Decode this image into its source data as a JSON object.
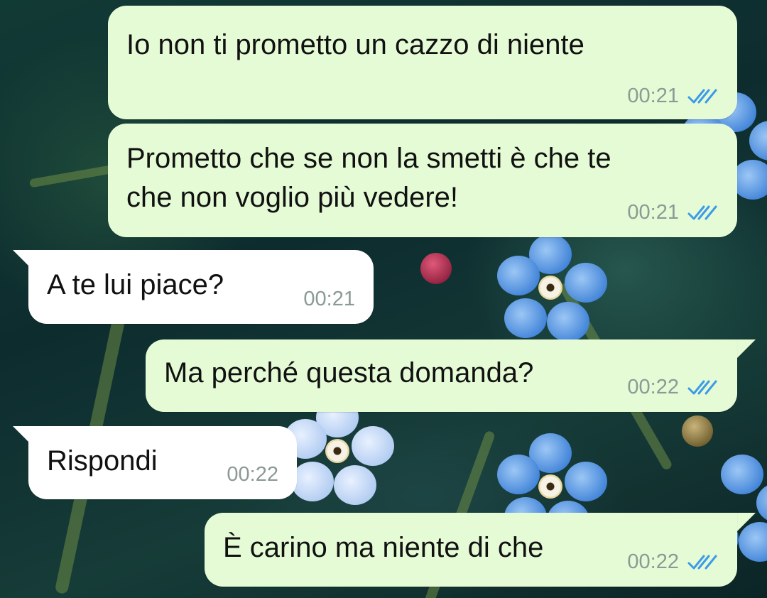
{
  "conversation": {
    "messages": [
      {
        "direction": "outgoing",
        "text": "Io non ti prometto un cazzo di niente",
        "time": "00:21",
        "status": "read"
      },
      {
        "direction": "outgoing",
        "text": "Prometto che se non la smetti è che te\nche non voglio più vedere!",
        "time": "00:21",
        "status": "read"
      },
      {
        "direction": "incoming",
        "text": "A te lui piace?",
        "time": "00:21"
      },
      {
        "direction": "outgoing",
        "text": "Ma perché questa domanda?",
        "time": "00:22",
        "status": "read"
      },
      {
        "direction": "incoming",
        "text": "Rispondi",
        "time": "00:22"
      },
      {
        "direction": "outgoing",
        "text": "È carino ma niente di che",
        "time": "00:22",
        "status": "read"
      }
    ]
  },
  "colors": {
    "outgoing_bubble": "#e5fbd6",
    "incoming_bubble": "#ffffff",
    "read_ticks": "#3d9ae8",
    "timestamp": "#8a9a94"
  },
  "icons": {
    "read_status": "double-check-icon"
  }
}
